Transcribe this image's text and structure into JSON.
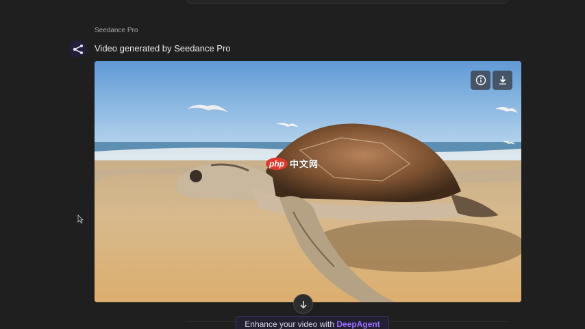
{
  "header": {
    "model_label": "Seedance Pro",
    "message_title": "Video generated by Seedance Pro"
  },
  "video": {
    "alt": "Sea turtle crawling on a sandy beach with seagulls flying overhead",
    "watermark_logo": "php",
    "watermark_text": "中文网"
  },
  "controls": {
    "info_icon": "info-icon",
    "download_icon": "download-icon",
    "scroll_icon": "arrow-down-icon"
  },
  "banner": {
    "prefix": "Enhance your video with",
    "accent": "DeepAgent",
    "accent_color": "#9b6dff"
  },
  "colors": {
    "background": "#1f1f1f",
    "avatar_bg": "#221e3c"
  }
}
